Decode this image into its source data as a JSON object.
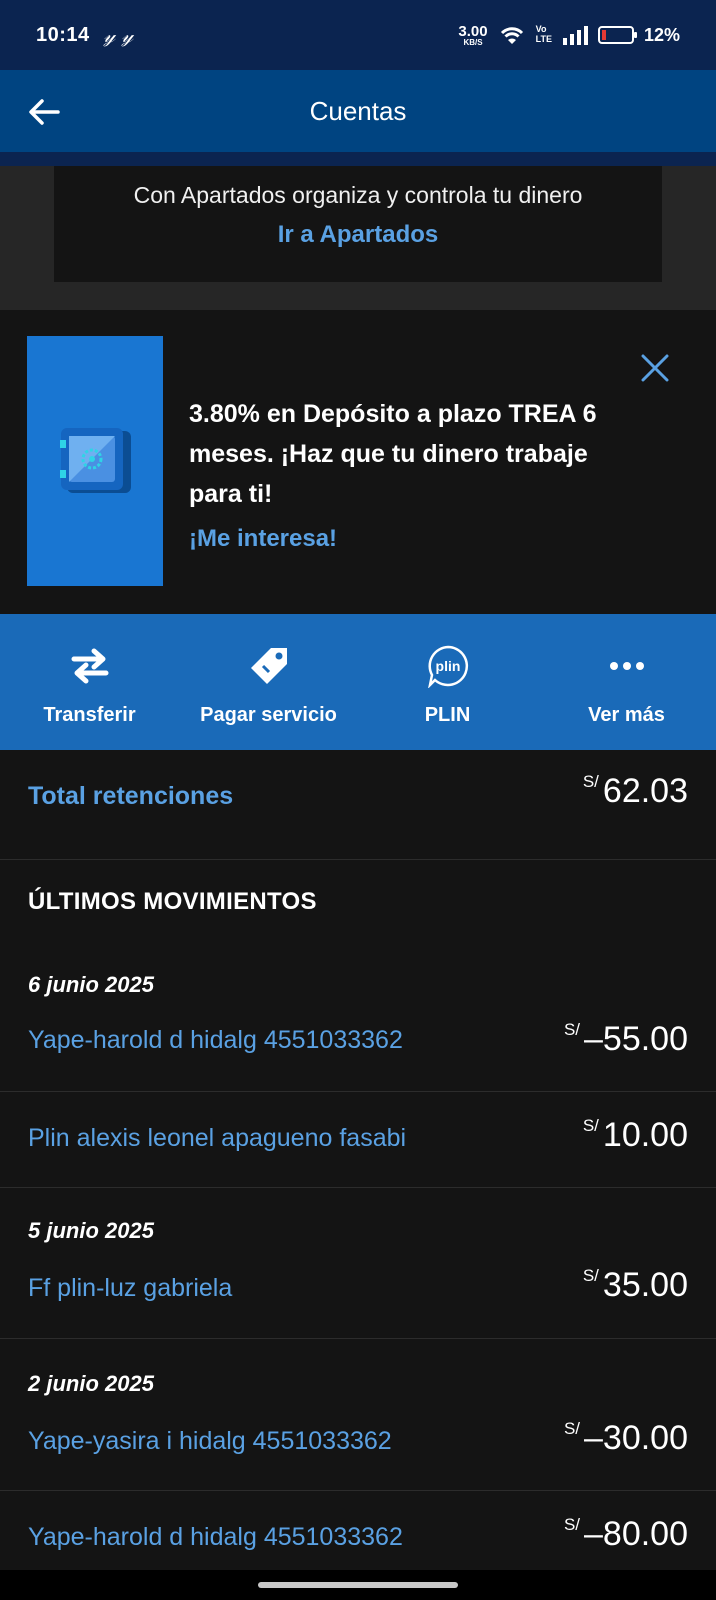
{
  "status_bar": {
    "time": "10:14",
    "notif_icons": "𝓎 𝓎",
    "net_speed": "3.00",
    "net_unit": "KB/S",
    "volte_top": "Vo",
    "volte_bottom": "LTE",
    "battery": "12%"
  },
  "header": {
    "title": "Cuentas"
  },
  "apartados": {
    "text": "Con Apartados organiza y controla tu dinero",
    "link": "Ir a Apartados"
  },
  "promo": {
    "text": "3.80% en Depósito a plazo TREA 6 meses. ¡Haz que tu dinero trabaje para ti!",
    "link": "¡Me interesa!"
  },
  "actions": [
    {
      "label": "Transferir",
      "icon": "transfer-arrows-icon"
    },
    {
      "label": "Pagar servicio",
      "icon": "price-tag-icon"
    },
    {
      "label": "PLIN",
      "icon": "plin-icon",
      "icon_text": "plin"
    },
    {
      "label": "Ver más",
      "icon": "more-dots-icon"
    }
  ],
  "retenciones": {
    "label": "Total retenciones",
    "currency": "S/",
    "amount": "62.03"
  },
  "movements_title": "ÚLTIMOS MOVIMIENTOS",
  "movements": [
    {
      "date": "6 junio 2025",
      "description": "Yape-harold d hidalg 4551033362",
      "currency": "S/",
      "amount": "–55.00"
    },
    {
      "date": "",
      "description": "Plin alexis leonel apagueno fasabi",
      "currency": "S/",
      "amount": "10.00"
    },
    {
      "date": "5 junio 2025",
      "description": "Ff plin-luz gabriela",
      "currency": "S/",
      "amount": "35.00"
    },
    {
      "date": "2 junio 2025",
      "description": "Yape-yasira i hidalg 4551033362",
      "currency": "S/",
      "amount": "–30.00"
    },
    {
      "date": "",
      "description": "Yape-harold d hidalg 4551033362",
      "currency": "S/",
      "amount": "–80.00"
    }
  ],
  "colors": {
    "accent": "#5aa1e3",
    "brand": "#004481",
    "action_bar": "#1a6ab8",
    "background": "#141414"
  }
}
